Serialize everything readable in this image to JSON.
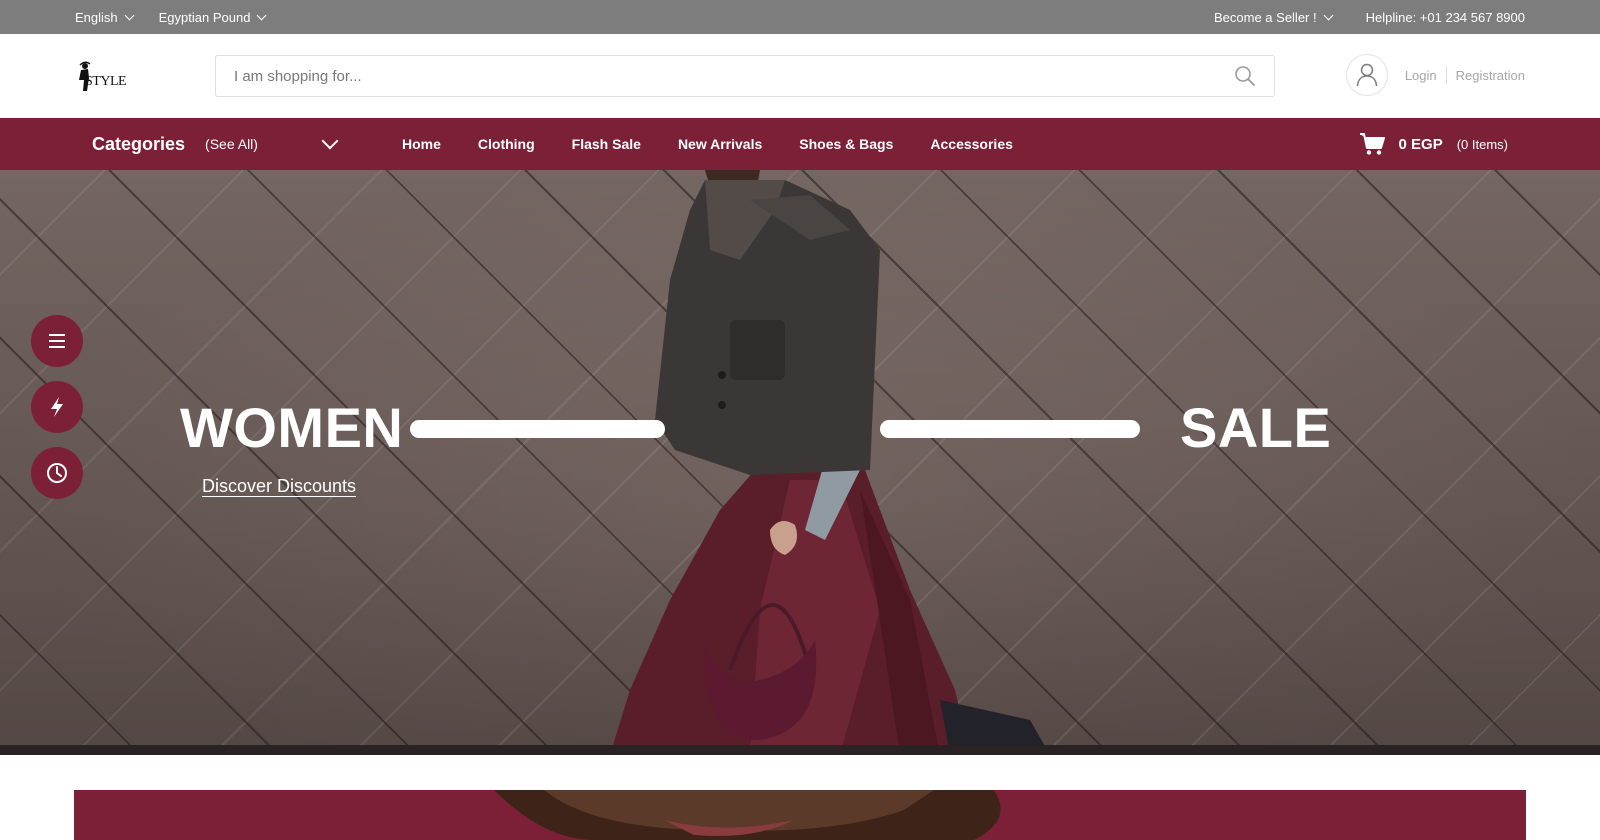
{
  "topbar": {
    "language": "English",
    "currency": "Egyptian Pound",
    "seller": "Become a Seller !",
    "helpline": "Helpline: +01 234 567 8900"
  },
  "header": {
    "logo_text": "STYLE",
    "search_placeholder": "I am shopping for...",
    "login": "Login",
    "registration": "Registration"
  },
  "nav": {
    "categories_title": "Categories",
    "categories_scope": "(See All)",
    "menu": [
      "Home",
      "Clothing",
      "Flash Sale",
      "New Arrivals",
      "Shoes & Bags",
      "Accessories"
    ],
    "cart_amount": "0 EGP",
    "cart_items": "(0 Items)"
  },
  "hero": {
    "left_title": "WOMEN",
    "right_title": "SALE",
    "cta": "Discover Discounts"
  },
  "floating_buttons": [
    "menu-icon",
    "lightning-icon",
    "clock-icon"
  ],
  "colors": {
    "brand": "#7c2037",
    "topbar": "#7d7d7d"
  }
}
